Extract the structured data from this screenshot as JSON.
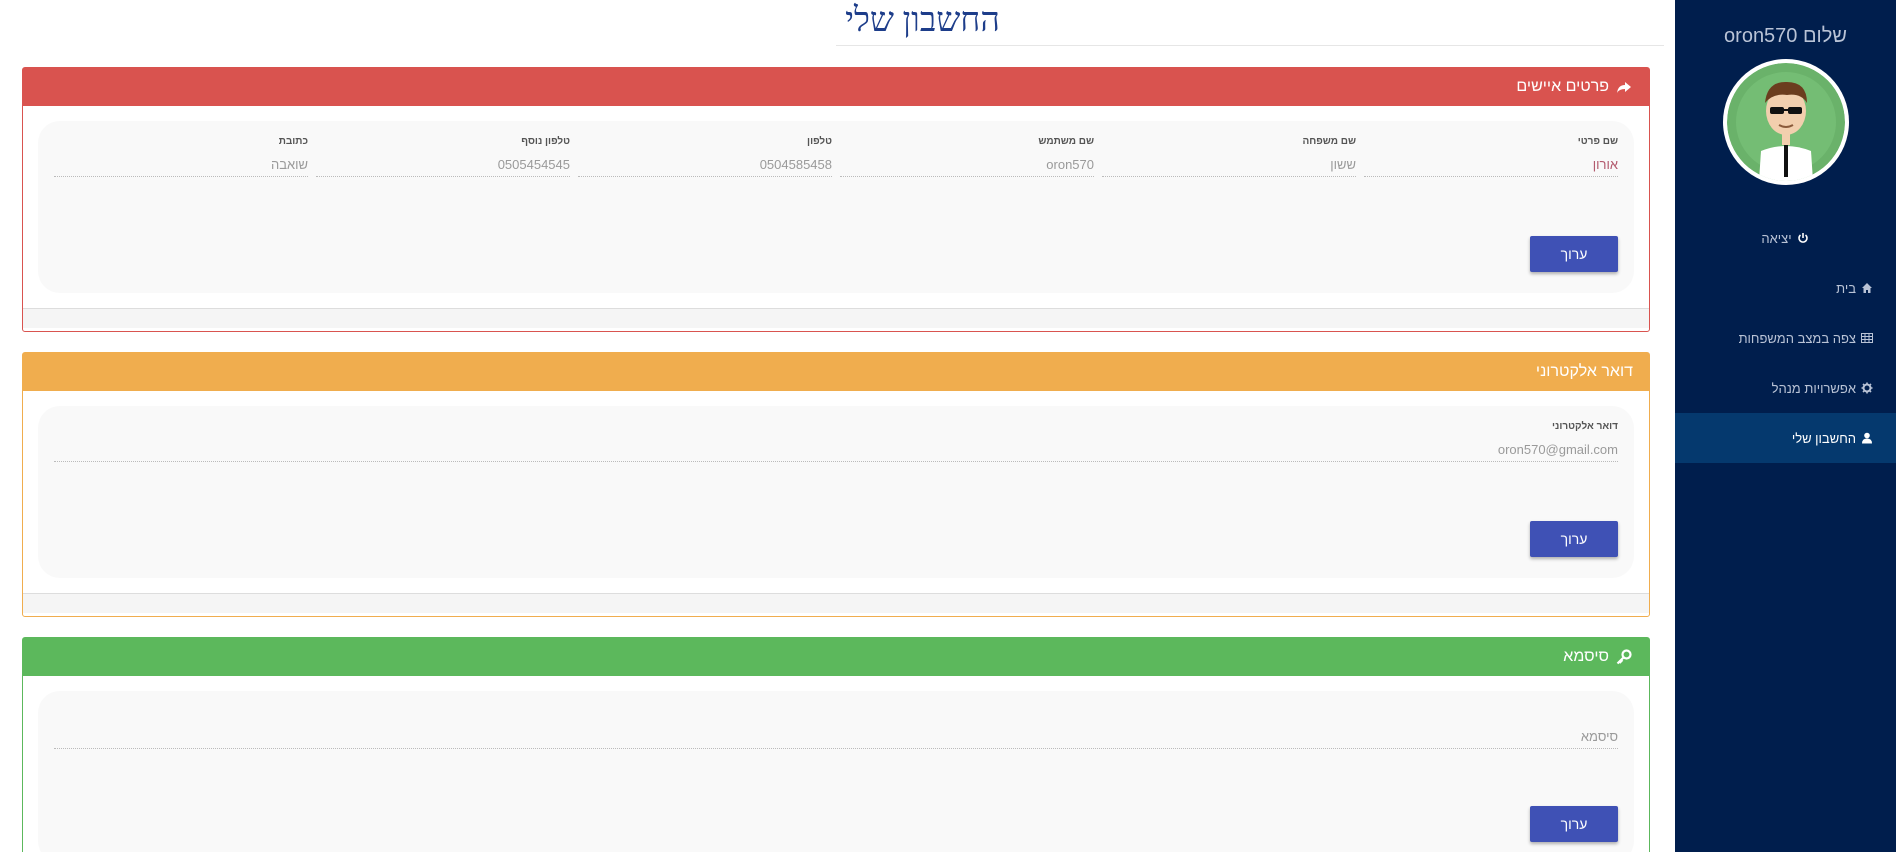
{
  "sidebar": {
    "greeting": "שלום oron570",
    "nav": [
      {
        "label": "יציאה",
        "icon": "power-icon"
      },
      {
        "label": "בית",
        "icon": "home-icon"
      },
      {
        "label": "צפה במצב המשפחות",
        "icon": "table-icon"
      },
      {
        "label": "אפשרויות מנהל",
        "icon": "gear-icon"
      },
      {
        "label": "החשבון שלי",
        "icon": "user-icon",
        "active": true
      }
    ]
  },
  "page": {
    "title": "החשבון שלי"
  },
  "personal": {
    "title": "פרטים איישים",
    "fields": [
      {
        "label": "שם פרטי",
        "value": "אורון"
      },
      {
        "label": "שם משפחה",
        "value": "ששון"
      },
      {
        "label": "שם משתמש",
        "value": "oron570"
      },
      {
        "label": "טלפון",
        "value": "0504585458"
      },
      {
        "label": "טלפון נוסף",
        "value": "0505454545"
      },
      {
        "label": "כתובת",
        "value": "שואבה"
      }
    ],
    "edit_label": "ערוך"
  },
  "email": {
    "title": "דואר אלקטרוני",
    "field_label": "דואר אלקטרוני",
    "value": "oron570@gmail.com",
    "edit_label": "ערוך"
  },
  "password": {
    "title": "סיסמא",
    "placeholder": "סיסמא",
    "edit_label": "ערוך"
  },
  "colors": {
    "sidebar_bg": "#001e4d",
    "sidebar_active": "#05396e",
    "personal_header": "#d9534f",
    "email_header": "#f0ad4e",
    "password_header": "#5cb85c",
    "button": "#3f51b5"
  }
}
